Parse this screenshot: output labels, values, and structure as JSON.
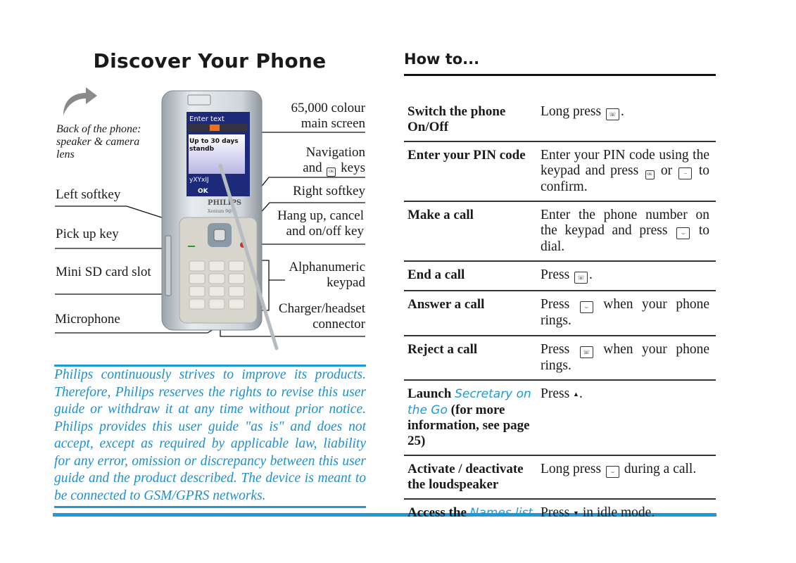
{
  "left": {
    "title": "Discover Your Phone",
    "back_note": "Back of the phone: speaker & camera lens",
    "callouts_left": [
      "Left softkey",
      "Pick up key",
      "Mini SD card slot",
      "Microphone"
    ],
    "callouts_right": [
      [
        "65,000 colour",
        "main screen"
      ],
      [
        "Navigation",
        "and",
        "keys"
      ],
      [
        "Right softkey"
      ],
      [
        "Hang up, cancel",
        "and on/off key"
      ],
      [
        "Alphanumeric",
        "keypad"
      ],
      [
        "Charger/headset",
        "connector"
      ]
    ],
    "phone": {
      "screen_title": "Enter text",
      "screen_line1": "Up to 30 days",
      "screen_line2": "standb",
      "screen_input": "yXYxIJ",
      "softkey_ok": "OK",
      "brand": "PHILIPS",
      "model": "Xenium 9@9"
    },
    "disclaimer": "Philips continuously strives to improve its products. Therefore, Philips reserves the rights to revise this user guide or withdraw it at any time without prior notice. Philips provides this user guide \"as is\" and does not accept, except as required by applicable law, liability for any error, omission or discrepancy between this user guide and the product described. The device is meant to be connected to GSM/GPRS networks."
  },
  "right": {
    "title": "How to...",
    "rows": [
      {
        "label": [
          {
            "t": "Switch the phone On/Off"
          }
        ],
        "desc": [
          {
            "t": "Long press "
          },
          {
            "icon": "hangup-key"
          },
          {
            "t": "."
          }
        ]
      },
      {
        "label": [
          {
            "t": "Enter your PIN code"
          }
        ],
        "desc": [
          {
            "t": "Enter your PIN code using the keypad and press "
          },
          {
            "icon": "ok-key"
          },
          {
            "t": " or "
          },
          {
            "icon": "left-softkey"
          },
          {
            "t": " to confirm."
          }
        ]
      },
      {
        "label": [
          {
            "t": "Make a call"
          }
        ],
        "desc": [
          {
            "t": "Enter the phone number on the keypad and press "
          },
          {
            "icon": "pickup-key"
          },
          {
            "t": " to dial."
          }
        ]
      },
      {
        "label": [
          {
            "t": "End a call"
          }
        ],
        "desc": [
          {
            "t": "Press "
          },
          {
            "icon": "hangup-key"
          },
          {
            "t": "."
          }
        ]
      },
      {
        "label": [
          {
            "t": "Answer a call"
          }
        ],
        "desc": [
          {
            "t": "Press "
          },
          {
            "icon": "pickup-key"
          },
          {
            "t": " when your phone rings."
          }
        ]
      },
      {
        "label": [
          {
            "t": "Reject a call"
          }
        ],
        "desc": [
          {
            "t": "Press "
          },
          {
            "icon": "hangup-key"
          },
          {
            "t": " when your phone rings."
          }
        ]
      },
      {
        "label": [
          {
            "t": "Launch "
          },
          {
            "t": "Secretary on the Go",
            "hl": true
          },
          {
            "t": " (for more information, see page 25)"
          }
        ],
        "desc": [
          {
            "t": "Press "
          },
          {
            "icon": "up-arrow"
          },
          {
            "t": "."
          }
        ]
      },
      {
        "label": [
          {
            "t": "Activate / deactivate the loudspeaker"
          }
        ],
        "desc": [
          {
            "t": "Long press "
          },
          {
            "icon": "pickup-key"
          },
          {
            "t": " during a call."
          }
        ]
      },
      {
        "label": [
          {
            "t": "Access the "
          },
          {
            "t": "Names list",
            "hl": true
          }
        ],
        "desc": [
          {
            "t": "Press "
          },
          {
            "icon": "down-arrow"
          },
          {
            "t": " in idle mode."
          }
        ]
      }
    ]
  },
  "colors": {
    "accent_blue": "#1e9ad6",
    "text": "#1a1a1a"
  }
}
